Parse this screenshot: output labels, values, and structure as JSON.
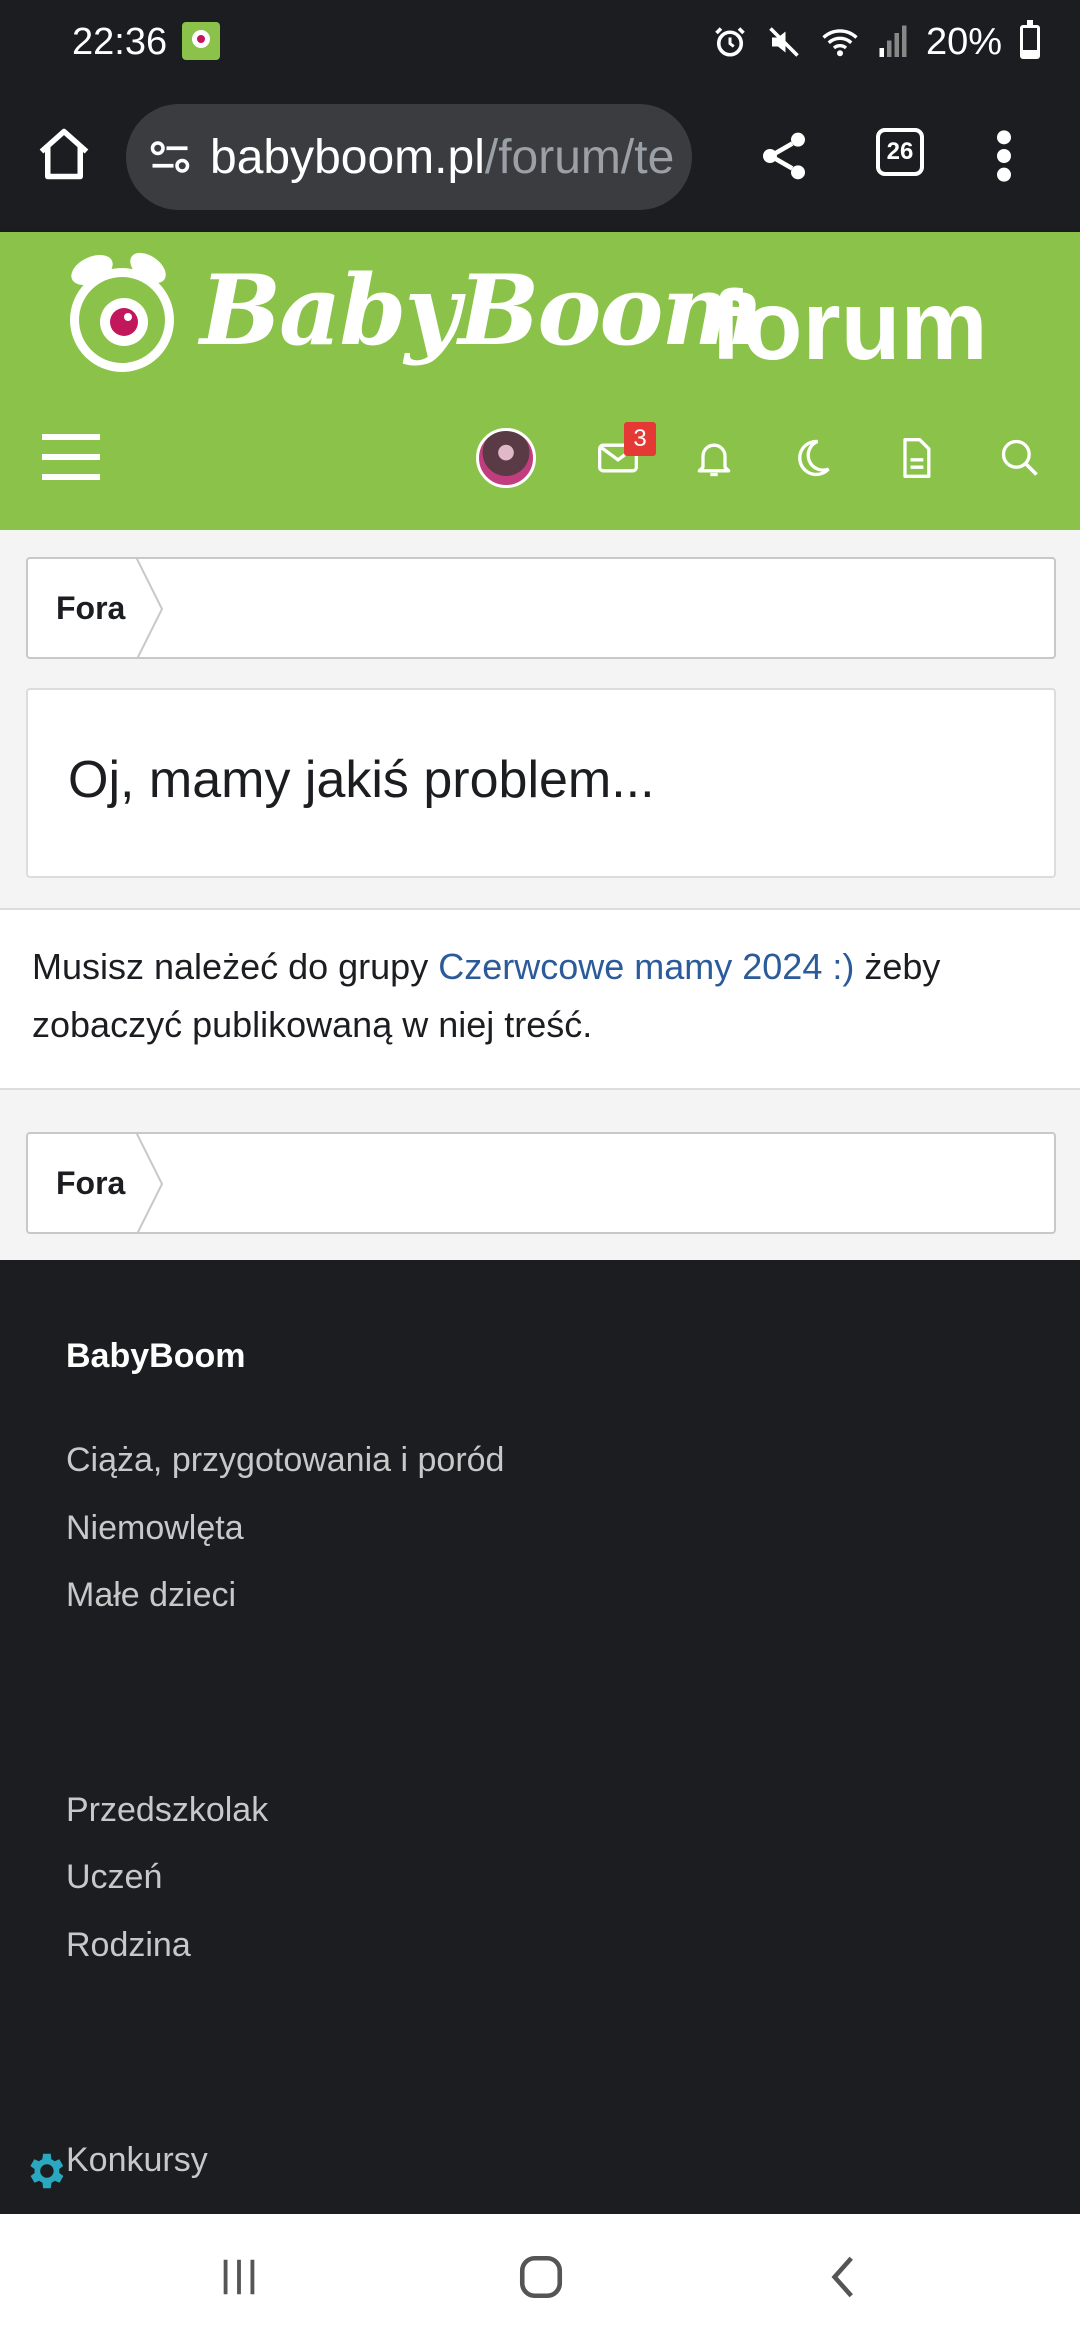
{
  "status_bar": {
    "time": "22:36",
    "battery_percent": "20%",
    "battery_level": 0.2,
    "icons": [
      "app-notification-icon",
      "alarm-icon",
      "mute-icon",
      "wifi-icon",
      "signal-icon",
      "battery-icon"
    ]
  },
  "browser": {
    "url_domain": "babyboom.pl",
    "url_path": "/forum/te",
    "tab_count": "26",
    "icons": [
      "home-icon",
      "site-settings-icon",
      "share-icon",
      "tabs-icon",
      "more-vert-icon"
    ]
  },
  "site_header": {
    "logo_text": "BabyBoom",
    "forum_label": "forum",
    "messages_badge": "3",
    "icons": [
      "menu-icon",
      "avatar",
      "mail-icon",
      "bell-icon",
      "moon-icon",
      "document-icon",
      "search-icon"
    ],
    "color": "#8bc34a"
  },
  "breadcrumb_top": {
    "label": "Fora"
  },
  "error": {
    "title": "Oj, mamy jakiś problem..."
  },
  "message": {
    "prefix": "Musisz należeć do grupy ",
    "group_link": "Czerwcowe mamy 2024 :)",
    "suffix": " żeby zobaczyć publikowaną w niej treść."
  },
  "breadcrumb_bottom": {
    "label": "Fora"
  },
  "footer": {
    "heading": "BabyBoom",
    "links_group1": [
      "Ciąża, przygotowania i poród",
      "Niemowlęta",
      "Małe dzieci"
    ],
    "links_group2": [
      "Przedszkolak",
      "Uczeń",
      "Rodzina"
    ],
    "links_group3": [
      "Konkursy"
    ]
  },
  "nav_bar": {
    "icons": [
      "recent-apps-icon",
      "home-button-icon",
      "back-icon"
    ]
  }
}
